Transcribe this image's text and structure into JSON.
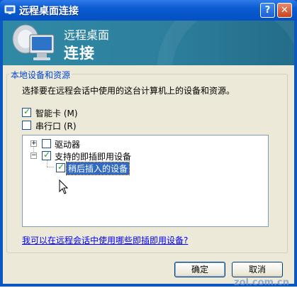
{
  "window": {
    "title": "远程桌面连接",
    "help_button": "?",
    "close_button": "✕"
  },
  "banner": {
    "line1": "远程桌面",
    "line2": "连接"
  },
  "group": {
    "legend": "本地设备和资源",
    "instructions": "选择要在远程会话中使用的这台计算机上的设备和资源。",
    "smartcard": {
      "label": "智能卡 (M)",
      "checked": true
    },
    "serial": {
      "label": "串行口 (R)",
      "checked": false
    }
  },
  "tree": {
    "items": [
      {
        "label": "驱动器",
        "expander": "+",
        "checked": false
      },
      {
        "label": "支持的即插即用设备",
        "expander": "−",
        "checked": true
      },
      {
        "label": "稍后插入的设备",
        "checked": true,
        "selected": true
      }
    ]
  },
  "link": {
    "text": "我可以在远程会话中使用哪些即插即用设备?"
  },
  "buttons": {
    "ok": "确定",
    "cancel": "取消"
  },
  "watermark": "zol.com.cn",
  "colors": {
    "title_bar": "#0a5bd1",
    "banner": "#2d7f9d",
    "link": "#0000ff",
    "selection": "#316ac5"
  }
}
